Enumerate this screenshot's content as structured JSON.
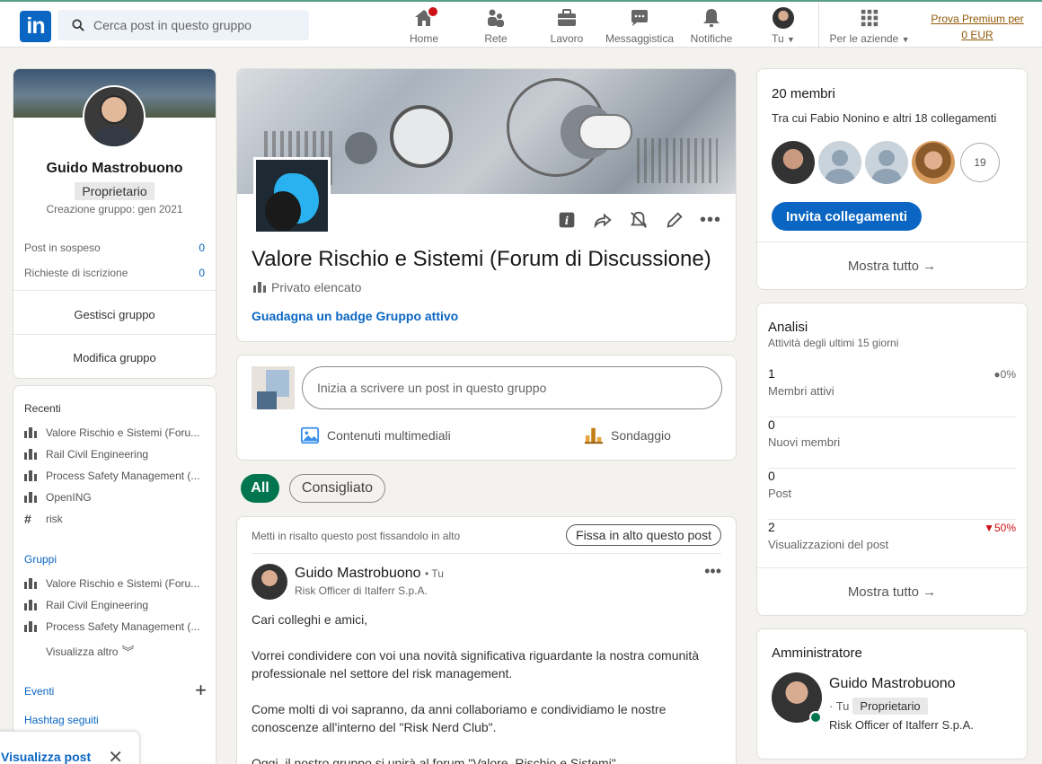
{
  "nav": {
    "search_placeholder": "Cerca post in questo gruppo",
    "items": [
      {
        "label": "Home",
        "icon": "home-icon"
      },
      {
        "label": "Rete",
        "icon": "network-icon"
      },
      {
        "label": "Lavoro",
        "icon": "briefcase-icon"
      },
      {
        "label": "Messaggistica",
        "icon": "messaging-icon"
      },
      {
        "label": "Notifiche",
        "icon": "bell-icon"
      },
      {
        "label": "Tu",
        "icon": "avatar"
      },
      {
        "label": "Per le aziende",
        "icon": "grid-icon"
      }
    ],
    "premium_line1": "Prova Premium per",
    "premium_line2": "0 EUR",
    "accent": "#0a66c2"
  },
  "profile": {
    "name": "Guido Mastrobuono",
    "role": "Proprietario",
    "created": "Creazione gruppo: gen 2021",
    "stats": [
      {
        "label": "Post in sospeso",
        "value": "0"
      },
      {
        "label": "Richieste di iscrizione",
        "value": "0"
      }
    ],
    "manage": "Gestisci gruppo",
    "edit": "Modifica gruppo"
  },
  "sidebar": {
    "recent_title": "Recenti",
    "recent": [
      {
        "label": "Valore Rischio e Sistemi (Foru...",
        "icon": "group-icon"
      },
      {
        "label": "Rail Civil Engineering",
        "icon": "group-icon"
      },
      {
        "label": "Process Safety Management (...",
        "icon": "group-icon"
      },
      {
        "label": "OpenING",
        "icon": "group-icon"
      },
      {
        "label": "risk",
        "icon": "hashtag-icon"
      }
    ],
    "groups_title": "Gruppi",
    "groups": [
      {
        "label": "Valore Rischio e Sistemi (Foru..."
      },
      {
        "label": "Rail Civil Engineering"
      },
      {
        "label": "Process Safety Management (..."
      }
    ],
    "show_more": "Visualizza altro",
    "events": "Eventi",
    "hashtags": "Hashtag seguiti"
  },
  "group": {
    "title": "Valore Rischio e Sistemi (Forum di Discussione)",
    "privacy": "Privato elencato",
    "badge_link": "Guadagna un badge Gruppo attivo"
  },
  "composer": {
    "placeholder": "Inizia a scrivere un post in questo gruppo",
    "media": "Contenuti multimediali",
    "poll": "Sondaggio"
  },
  "filters": {
    "all": "All",
    "recommended": "Consigliato"
  },
  "post": {
    "pin_note": "Metti in risalto questo post fissandolo in alto",
    "pin_button": "Fissa in alto questo post",
    "author": "Guido Mastrobuono",
    "you": "• Tu",
    "subtitle": "Risk Officer di Italferr S.p.A.",
    "paragraphs": [
      "Cari colleghi e amici,",
      "Vorrei condividere con voi una novità significativa riguardante la nostra comunità professionale nel settore del risk management.",
      "Come molti di voi sapranno, da anni collaboriamo e condividiamo le nostre conoscenze all'interno del \"Risk Nerd Club\".",
      "Oggi, il nostro gruppo si unirà al forum \"Valore, Rischio e Sistemi\"."
    ]
  },
  "members": {
    "count_title": "20 membri",
    "subtitle": "Tra cui Fabio Nonino e altri 18 collegamenti",
    "more_count": "19",
    "invite": "Invita collegamenti",
    "show_all": "Mostra tutto →"
  },
  "analytics": {
    "title": "Analisi",
    "subtitle": "Attività degli ultimi 15 giorni",
    "rows": [
      {
        "value": "1",
        "label": "Membri attivi",
        "delta": "●0%",
        "delta_color": "#666666"
      },
      {
        "value": "0",
        "label": "Nuovi membri",
        "delta": "",
        "delta_color": "#666666"
      },
      {
        "value": "0",
        "label": "Post",
        "delta": "",
        "delta_color": "#666666"
      },
      {
        "value": "2",
        "label": "Visualizzazioni del post",
        "delta": "▼50%",
        "delta_color": "#cc1016"
      }
    ],
    "show_all": "Mostra tutto →"
  },
  "admin": {
    "title": "Amministratore",
    "name": "Guido Mastrobuono",
    "you": "· Tu",
    "role": "Proprietario",
    "subtitle": "Risk Officer of Italferr S.p.A."
  },
  "messaging": {
    "label": "Visualizza post"
  }
}
